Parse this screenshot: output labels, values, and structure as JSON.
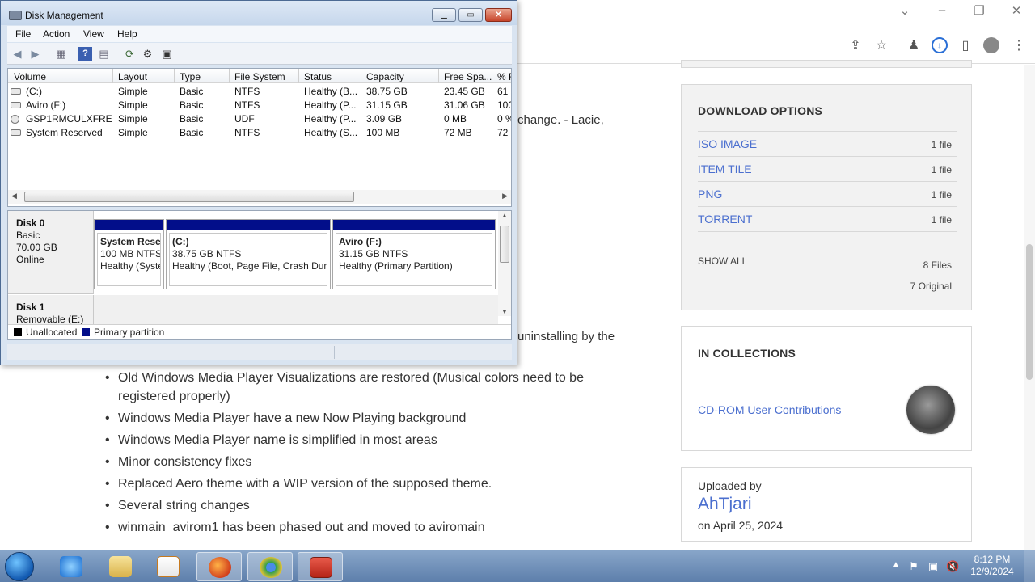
{
  "dm": {
    "title": "Disk Management",
    "menu": [
      "File",
      "Action",
      "View",
      "Help"
    ],
    "columns": [
      "Volume",
      "Layout",
      "Type",
      "File System",
      "Status",
      "Capacity",
      "Free Spa...",
      "% F"
    ],
    "volumes": [
      {
        "volume": "(C:)",
        "layout": "Simple",
        "type": "Basic",
        "fs": "NTFS",
        "status": "Healthy (B...",
        "capacity": "38.75 GB",
        "free": "23.45 GB",
        "pct": "61"
      },
      {
        "volume": "Aviro (F:)",
        "layout": "Simple",
        "type": "Basic",
        "fs": "NTFS",
        "status": "Healthy (P...",
        "capacity": "31.15 GB",
        "free": "31.06 GB",
        "pct": "100"
      },
      {
        "volume": "GSP1RMCULXFRE...",
        "layout": "Simple",
        "type": "Basic",
        "fs": "UDF",
        "status": "Healthy (P...",
        "capacity": "3.09 GB",
        "free": "0 MB",
        "pct": "0 %"
      },
      {
        "volume": "System Reserved",
        "layout": "Simple",
        "type": "Basic",
        "fs": "NTFS",
        "status": "Healthy (S...",
        "capacity": "100 MB",
        "free": "72 MB",
        "pct": "72"
      }
    ],
    "disk0": {
      "name": "Disk 0",
      "kind": "Basic",
      "size": "70.00 GB",
      "state": "Online",
      "partitions": [
        {
          "name": "System Rese",
          "size": "100 MB NTFS",
          "status": "Healthy (Syste"
        },
        {
          "name": "(C:)",
          "size": "38.75 GB NTFS",
          "status": "Healthy (Boot, Page File, Crash Dum"
        },
        {
          "name": "Aviro  (F:)",
          "size": "31.15 GB NTFS",
          "status": "Healthy (Primary Partition)"
        }
      ]
    },
    "disk1": {
      "name": "Disk 1",
      "kind": "Removable (E:)"
    },
    "legend": {
      "unallocated": "Unallocated",
      "primary": "Primary partition"
    }
  },
  "page": {
    "fragment1": "change. - Lacie,",
    "fragment2": "uninstalling by the",
    "bullets": [
      "Old Windows Media Player Visualizations are restored (Musical colors need to be registered properly)",
      "Windows Media Player have a new Now Playing background",
      "Windows Media Player name is simplified in most areas",
      "Minor consistency fixes",
      "Replaced Aero theme with a WIP version of the supposed theme.",
      "Several string changes",
      "winmain_avirom1 has been phased out and moved to aviromain"
    ]
  },
  "download": {
    "title": "DOWNLOAD OPTIONS",
    "rows": [
      {
        "label": "ISO IMAGE",
        "count": "1 file"
      },
      {
        "label": "ITEM TILE",
        "count": "1 file"
      },
      {
        "label": "PNG",
        "count": "1 file"
      },
      {
        "label": "TORRENT",
        "count": "1 file"
      }
    ],
    "show_all": "SHOW ALL",
    "files": "8 Files",
    "original": "7 Original"
  },
  "collections": {
    "title": "IN COLLECTIONS",
    "link": "CD-ROM User Contributions"
  },
  "uploader": {
    "label": "Uploaded by",
    "name": "AhTjari",
    "date": "on April 25, 2024"
  },
  "taskbar": {
    "time": "8:12 PM",
    "date": "12/9/2024"
  },
  "colors": {
    "primary_partition": "#020e8a",
    "link": "#4b6fcf"
  }
}
